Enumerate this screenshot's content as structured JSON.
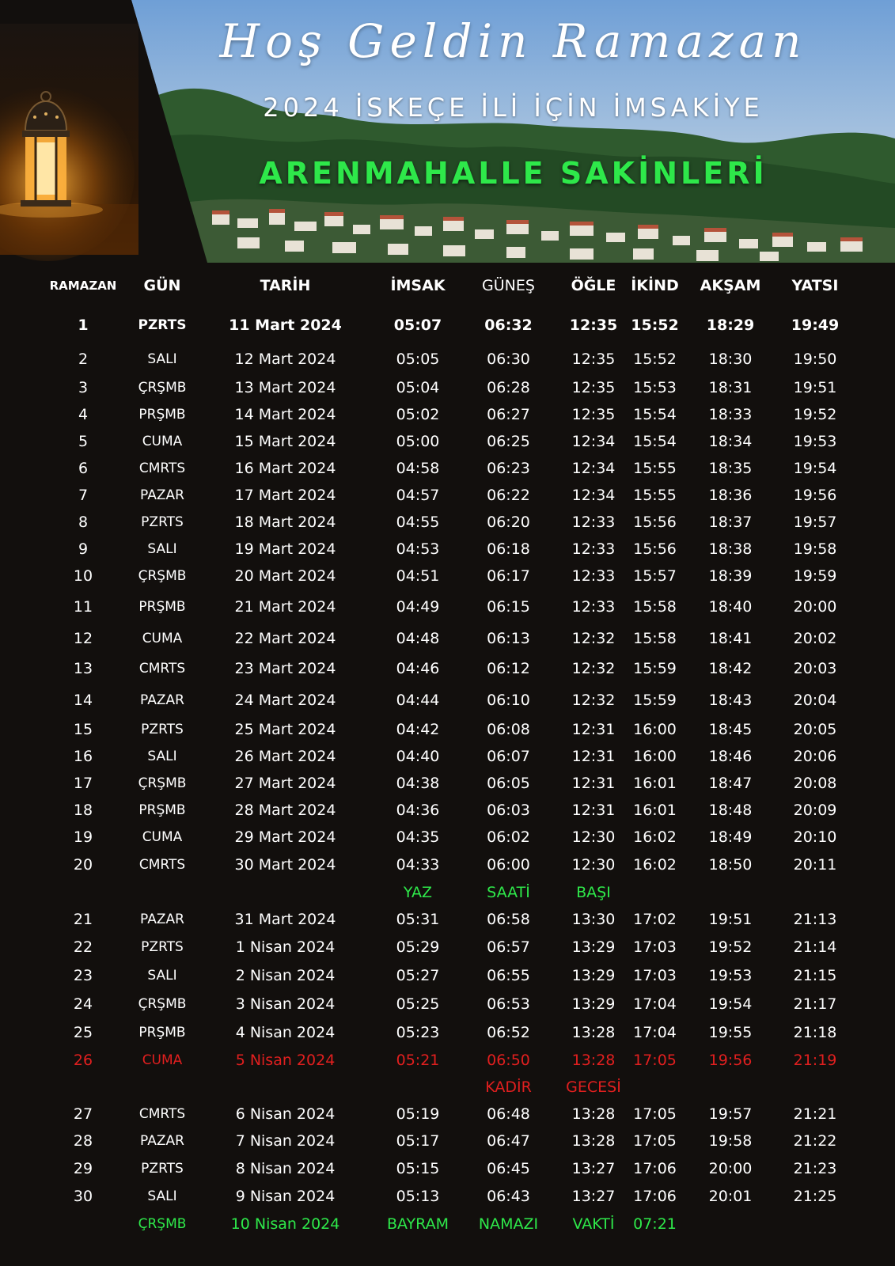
{
  "header": {
    "title": "Hoş Geldin Ramazan",
    "subtitle": "2024 İSKEÇE İLİ İÇİN İMSAKİYE",
    "community": "ARENMAHALLE SAKİNLERİ",
    "accent_green": "#2ee84a",
    "accent_red": "#e11f1f",
    "image_lantern": "lantern-photo",
    "image_village": "village-landscape-photo"
  },
  "columns": [
    "RAMAZAN",
    "GÜN",
    "TARİH",
    "İMSAK",
    "GÜNEŞ",
    "ÖĞLE",
    "İKİND",
    "AKŞAM",
    "YATSI"
  ],
  "rows": [
    {
      "style": "bold",
      "cells": [
        "1",
        "PZRTS",
        "11 Mart 2024",
        "05:07",
        "06:32",
        "12:35",
        "15:52",
        "18:29",
        "19:49"
      ]
    },
    {
      "cells": [
        "2",
        "SALI",
        "12 Mart 2024",
        "05:05",
        "06:30",
        "12:35",
        "15:52",
        "18:30",
        "19:50"
      ]
    },
    {
      "cells": [
        "3",
        "ÇRŞMB",
        "13 Mart 2024",
        "05:04",
        "06:28",
        "12:35",
        "15:53",
        "18:31",
        "19:51"
      ]
    },
    {
      "cells": [
        "4",
        "PRŞMB",
        "14 Mart 2024",
        "05:02",
        "06:27",
        "12:35",
        "15:54",
        "18:33",
        "19:52"
      ]
    },
    {
      "cells": [
        "5",
        "CUMA",
        "15 Mart 2024",
        "05:00",
        "06:25",
        "12:34",
        "15:54",
        "18:34",
        "19:53"
      ]
    },
    {
      "cells": [
        "6",
        "CMRTS",
        "16 Mart 2024",
        "04:58",
        "06:23",
        "12:34",
        "15:55",
        "18:35",
        "19:54"
      ]
    },
    {
      "cells": [
        "7",
        "PAZAR",
        "17 Mart 2024",
        "04:57",
        "06:22",
        "12:34",
        "15:55",
        "18:36",
        "19:56"
      ]
    },
    {
      "cells": [
        "8",
        "PZRTS",
        "18 Mart 2024",
        "04:55",
        "06:20",
        "12:33",
        "15:56",
        "18:37",
        "19:57"
      ]
    },
    {
      "cells": [
        "9",
        "SALI",
        "19 Mart 2024",
        "04:53",
        "06:18",
        "12:33",
        "15:56",
        "18:38",
        "19:58"
      ]
    },
    {
      "cells": [
        "10",
        "ÇRŞMB",
        "20 Mart 2024",
        "04:51",
        "06:17",
        "12:33",
        "15:57",
        "18:39",
        "19:59"
      ]
    },
    {
      "cells": [
        "11",
        "PRŞMB",
        "21 Mart 2024",
        "04:49",
        "06:15",
        "12:33",
        "15:58",
        "18:40",
        "20:00"
      ]
    },
    {
      "cells": [
        "12",
        "CUMA",
        "22 Mart 2024",
        "04:48",
        "06:13",
        "12:32",
        "15:58",
        "18:41",
        "20:02"
      ]
    },
    {
      "cells": [
        "13",
        "CMRTS",
        "23 Mart 2024",
        "04:46",
        "06:12",
        "12:32",
        "15:59",
        "18:42",
        "20:03"
      ]
    },
    {
      "cells": [
        "14",
        "PAZAR",
        "24 Mart 2024",
        "04:44",
        "06:10",
        "12:32",
        "15:59",
        "18:43",
        "20:04"
      ]
    },
    {
      "cells": [
        "15",
        "PZRTS",
        "25 Mart 2024",
        "04:42",
        "06:08",
        "12:31",
        "16:00",
        "18:45",
        "20:05"
      ]
    },
    {
      "cells": [
        "16",
        "SALI",
        "26 Mart 2024",
        "04:40",
        "06:07",
        "12:31",
        "16:00",
        "18:46",
        "20:06"
      ]
    },
    {
      "cells": [
        "17",
        "ÇRŞMB",
        "27 Mart 2024",
        "04:38",
        "06:05",
        "12:31",
        "16:01",
        "18:47",
        "20:08"
      ]
    },
    {
      "cells": [
        "18",
        "PRŞMB",
        "28 Mart 2024",
        "04:36",
        "06:03",
        "12:31",
        "16:01",
        "18:48",
        "20:09"
      ]
    },
    {
      "cells": [
        "19",
        "CUMA",
        "29 Mart 2024",
        "04:35",
        "06:02",
        "12:30",
        "16:02",
        "18:49",
        "20:10"
      ]
    },
    {
      "cells": [
        "20",
        "CMRTS",
        "30 Mart 2024",
        "04:33",
        "06:00",
        "12:30",
        "16:02",
        "18:50",
        "20:11"
      ]
    },
    {
      "style": "green note",
      "cells": [
        "",
        "",
        "",
        "YAZ",
        "SAATİ",
        "BAŞI",
        "",
        "",
        ""
      ]
    },
    {
      "cells": [
        "21",
        "PAZAR",
        "31 Mart 2024",
        "05:31",
        "06:58",
        "13:30",
        "17:02",
        "19:51",
        "21:13"
      ]
    },
    {
      "cells": [
        "22",
        "PZRTS",
        "1 Nisan 2024",
        "05:29",
        "06:57",
        "13:29",
        "17:03",
        "19:52",
        "21:14"
      ]
    },
    {
      "cells": [
        "23",
        "SALI",
        "2 Nisan 2024",
        "05:27",
        "06:55",
        "13:29",
        "17:03",
        "19:53",
        "21:15"
      ]
    },
    {
      "cells": [
        "24",
        "ÇRŞMB",
        "3 Nisan 2024",
        "05:25",
        "06:53",
        "13:29",
        "17:04",
        "19:54",
        "21:17"
      ]
    },
    {
      "cells": [
        "25",
        "PRŞMB",
        "4 Nisan 2024",
        "05:23",
        "06:52",
        "13:28",
        "17:04",
        "19:55",
        "21:18"
      ]
    },
    {
      "style": "red",
      "cells": [
        "26",
        "CUMA",
        "5 Nisan 2024",
        "05:21",
        "06:50",
        "13:28",
        "17:05",
        "19:56",
        "21:19"
      ]
    },
    {
      "style": "red note",
      "cells": [
        "",
        "",
        "",
        "",
        "KADİR",
        "GECESİ",
        "",
        "",
        ""
      ]
    },
    {
      "cells": [
        "27",
        "CMRTS",
        "6 Nisan 2024",
        "05:19",
        "06:48",
        "13:28",
        "17:05",
        "19:57",
        "21:21"
      ]
    },
    {
      "cells": [
        "28",
        "PAZAR",
        "7 Nisan 2024",
        "05:17",
        "06:47",
        "13:28",
        "17:05",
        "19:58",
        "21:22"
      ]
    },
    {
      "cells": [
        "29",
        "PZRTS",
        "8 Nisan 2024",
        "05:15",
        "06:45",
        "13:27",
        "17:06",
        "20:00",
        "21:23"
      ]
    },
    {
      "cells": [
        "30",
        "SALI",
        "9 Nisan 2024",
        "05:13",
        "06:43",
        "13:27",
        "17:06",
        "20:01",
        "21:25"
      ]
    },
    {
      "style": "green",
      "cells": [
        "",
        "ÇRŞMB",
        "10 Nisan 2024",
        "BAYRAM",
        "NAMAZI",
        "VAKTİ",
        "07:21",
        "",
        ""
      ]
    }
  ]
}
